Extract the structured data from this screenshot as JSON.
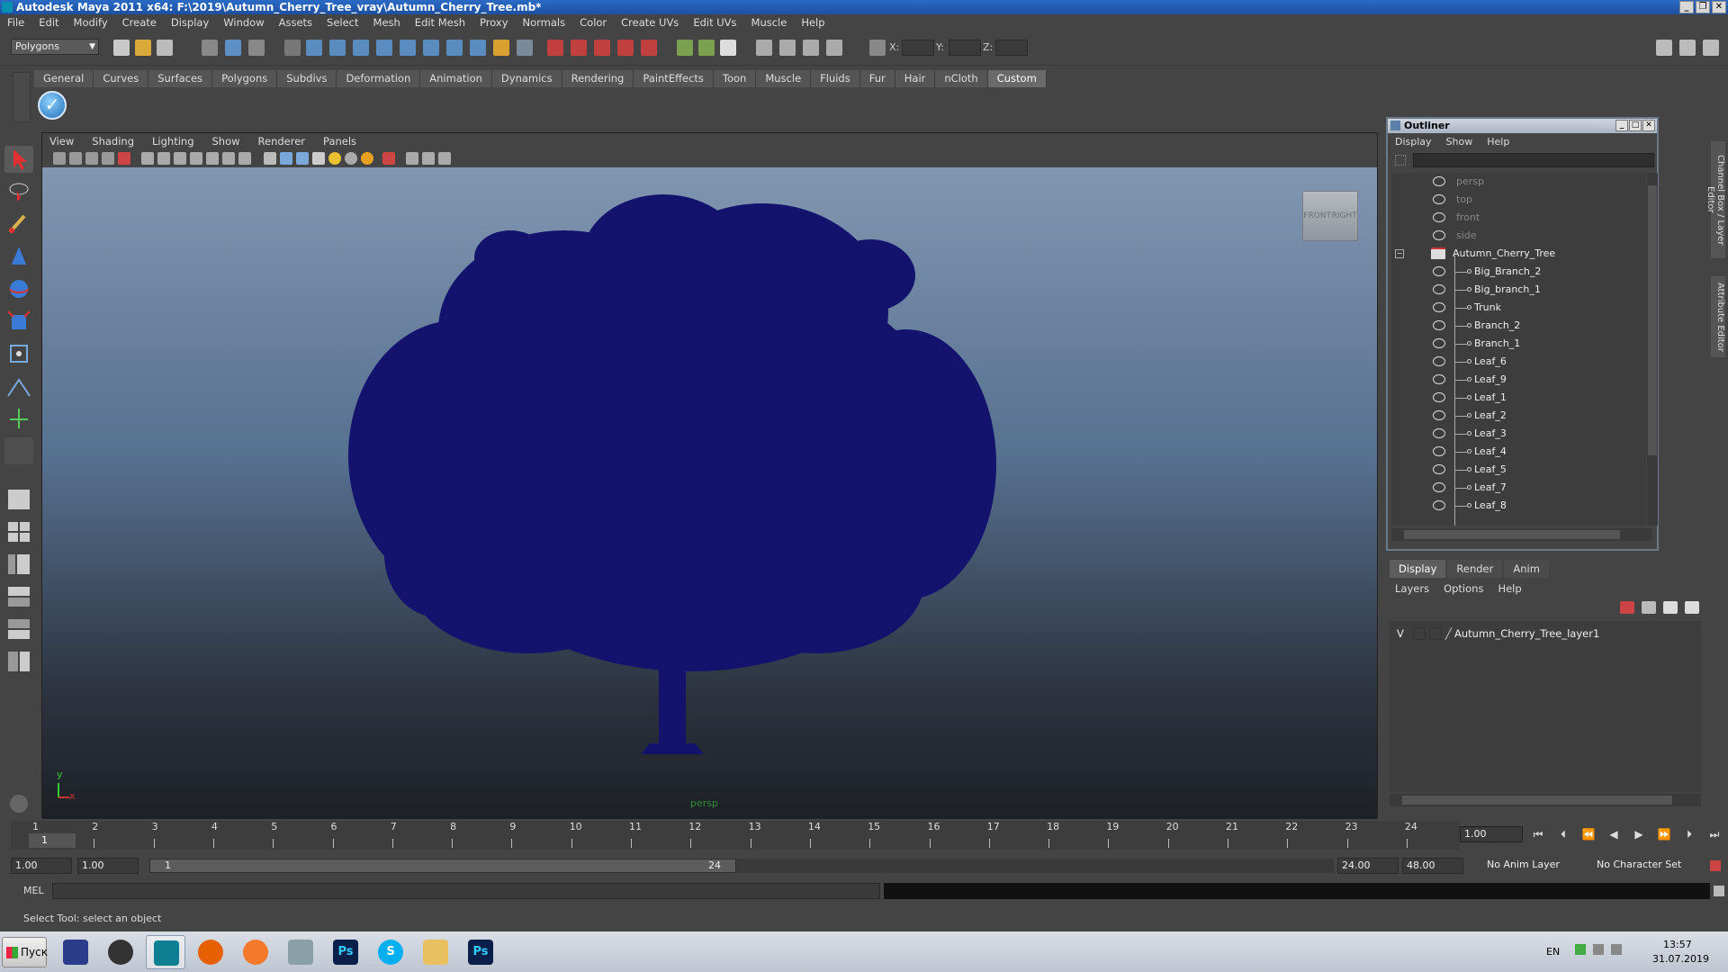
{
  "window": {
    "title": "Autodesk Maya 2011 x64: F:\\2019\\Autumn_Cherry_Tree_vray\\Autumn_Cherry_Tree.mb*"
  },
  "menubar": [
    "File",
    "Edit",
    "Modify",
    "Create",
    "Display",
    "Window",
    "Assets",
    "Select",
    "Mesh",
    "Edit Mesh",
    "Proxy",
    "Normals",
    "Color",
    "Create UVs",
    "Edit UVs",
    "Muscle",
    "Help"
  ],
  "statusline": {
    "mode": "Polygons",
    "x_label": "X:",
    "y_label": "Y:",
    "z_label": "Z:"
  },
  "shelf_tabs": [
    "General",
    "Curves",
    "Surfaces",
    "Polygons",
    "Subdivs",
    "Deformation",
    "Animation",
    "Dynamics",
    "Rendering",
    "PaintEffects",
    "Toon",
    "Muscle",
    "Fluids",
    "Fur",
    "Hair",
    "nCloth",
    "Custom"
  ],
  "shelf_active": "Custom",
  "viewport": {
    "menu": [
      "View",
      "Shading",
      "Lighting",
      "Show",
      "Renderer",
      "Panels"
    ],
    "camera": "persp",
    "viewcube": {
      "left": "FRONT",
      "right": "RIGHT"
    },
    "axis_y": "y",
    "axis_x": "x"
  },
  "outliner": {
    "title": "Outliner",
    "menu": [
      "Display",
      "Show",
      "Help"
    ],
    "cameras": [
      "persp",
      "top",
      "front",
      "side"
    ],
    "group": "Autumn_Cherry_Tree",
    "children": [
      "Big_Branch_2",
      "Big_branch_1",
      "Trunk",
      "Branch_2",
      "Branch_1",
      "Leaf_6",
      "Leaf_9",
      "Leaf_1",
      "Leaf_2",
      "Leaf_3",
      "Leaf_4",
      "Leaf_5",
      "Leaf_7",
      "Leaf_8"
    ]
  },
  "layer_editor": {
    "tabs": [
      "Display",
      "Render",
      "Anim"
    ],
    "active_tab": "Display",
    "menu": [
      "Layers",
      "Options",
      "Help"
    ],
    "visible_flag": "V",
    "layer_name": "Autumn_Cherry_Tree_layer1"
  },
  "side_tabs": [
    "Channel Box / Layer Editor",
    "Attribute Editor"
  ],
  "timeslider": {
    "frames": [
      "1",
      "2",
      "3",
      "4",
      "5",
      "6",
      "7",
      "8",
      "9",
      "10",
      "11",
      "12",
      "13",
      "14",
      "15",
      "16",
      "17",
      "18",
      "19",
      "20",
      "21",
      "22",
      "23",
      "24"
    ],
    "current_marker": "1",
    "current_frame": "1.00"
  },
  "range": {
    "start": "1.00",
    "playback_start": "1.00",
    "slider_start": "1",
    "slider_end": "24",
    "playback_end": "24.00",
    "end": "48.00",
    "anim_layer": "No Anim Layer",
    "character_set": "No Character Set"
  },
  "cmdline": {
    "label": "MEL"
  },
  "helpline": {
    "text": "Select Tool: select an object"
  },
  "taskbar": {
    "start": "Пуск",
    "lang": "EN",
    "time": "13:57",
    "date": "31.07.2019"
  }
}
